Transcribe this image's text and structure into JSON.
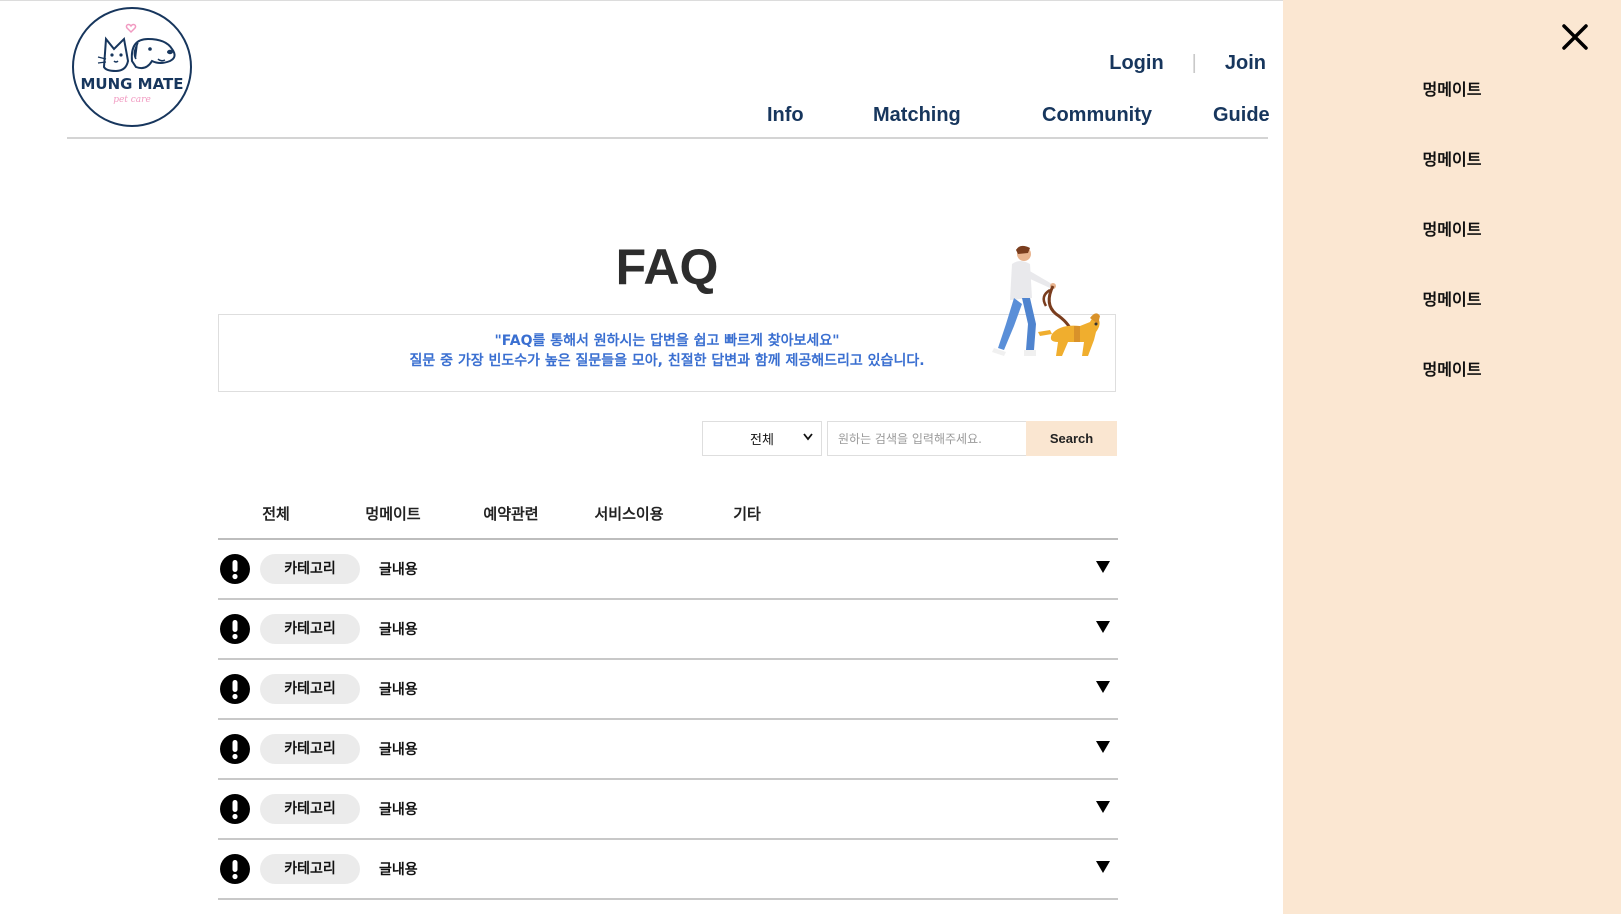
{
  "logo": {
    "name": "MUNG MATE",
    "tagline": "pet care"
  },
  "auth": {
    "login": "Login",
    "separator": "|",
    "join": "Join"
  },
  "nav": [
    "Info",
    "Matching",
    "Community",
    "Guide"
  ],
  "faq": {
    "title": "FAQ",
    "intro_line1": "\"FAQ를 통해서 원하시는 답변을 쉽고 빠르게 찾아보세요\"",
    "intro_line2": "질문 중 가장 빈도수가 높은 질문들을 모아, 친절한 답변과 함께 제공해드리고 있습니다."
  },
  "search": {
    "select_value": "전체",
    "placeholder": "원하는 검색을 입력해주세요.",
    "button": "Search"
  },
  "tabs": [
    "전체",
    "멍메이트",
    "예약관련",
    "서비스이용",
    "기타"
  ],
  "faq_rows": [
    {
      "category": "카테고리",
      "text": "글내용"
    },
    {
      "category": "카테고리",
      "text": "글내용"
    },
    {
      "category": "카테고리",
      "text": "글내용"
    },
    {
      "category": "카테고리",
      "text": "글내용"
    },
    {
      "category": "카테고리",
      "text": "글내용"
    },
    {
      "category": "카테고리",
      "text": "글내용"
    }
  ],
  "side_menu": [
    "멍메이트",
    "멍메이트",
    "멍메이트",
    "멍메이트",
    "멍메이트"
  ],
  "colors": {
    "navy": "#17365d",
    "intro_blue": "#3a6fd1",
    "panel_bg": "#fbe7d2",
    "search_button_bg": "#fae6d1",
    "chip_bg": "#ebebeb"
  },
  "icons": {
    "row_icon": "exclamation-circle-icon",
    "row_toggle": "triangle-down-icon",
    "close": "close-icon",
    "select": "chevron-down-icon"
  }
}
